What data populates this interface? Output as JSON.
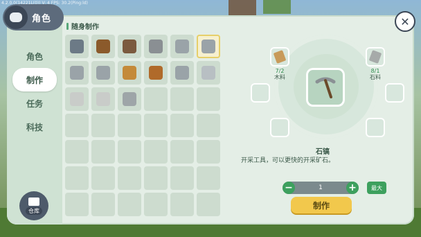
{
  "debug": "4.2.0.0(14221L(0)) V: 4 FPS: 30.2(Ping:ld)",
  "sidebar": {
    "title": "角色",
    "items": [
      {
        "label": "角色",
        "active": false
      },
      {
        "label": "制作",
        "active": true
      },
      {
        "label": "任务",
        "active": false
      },
      {
        "label": "科技",
        "active": false
      }
    ],
    "storage_label": "仓库"
  },
  "grid": {
    "title": "随身制作",
    "items": [
      {
        "icon": "workbench-icon",
        "color": "#6c7a86"
      },
      {
        "icon": "torch-icon",
        "color": "#8b5a2b"
      },
      {
        "icon": "dirt-block-icon",
        "color": "#7b5a3f"
      },
      {
        "icon": "stone-block-icon",
        "color": "#8a8f93"
      },
      {
        "icon": "stone-axe-icon",
        "color": "#9aa3a8"
      },
      {
        "icon": "stone-pickaxe-icon",
        "color": "#9aa3a8",
        "selected": true
      },
      {
        "icon": "stone-shovel-icon",
        "color": "#9aa3a8"
      },
      {
        "icon": "stone-rake-icon",
        "color": "#9aa3a8"
      },
      {
        "icon": "stone-spear-icon",
        "color": "#c48a3a"
      },
      {
        "icon": "wooden-shield-icon",
        "color": "#b06a2a"
      },
      {
        "icon": "stone-sword-icon",
        "color": "#9aa3a8"
      },
      {
        "icon": "stone-tablet-icon",
        "color": "#b8bfc3"
      },
      {
        "icon": "bone-icon",
        "color": "#c9ccc9"
      },
      {
        "icon": "plate-icon",
        "color": "#c9ccc9"
      },
      {
        "icon": "bowl-icon",
        "color": "#9ea5a8"
      }
    ]
  },
  "detail": {
    "item_name": "石镐",
    "description": "开采工具，可以更快的开采矿石。",
    "materials": [
      {
        "qty": "7/2",
        "name": "木料",
        "icon": "wood-icon",
        "color": "#c89a5a"
      },
      {
        "qty": "8/1",
        "name": "石料",
        "icon": "stone-icon",
        "color": "#a6aaa9"
      }
    ],
    "quantity": "1",
    "max_label": "最大",
    "craft_label": "制作"
  }
}
